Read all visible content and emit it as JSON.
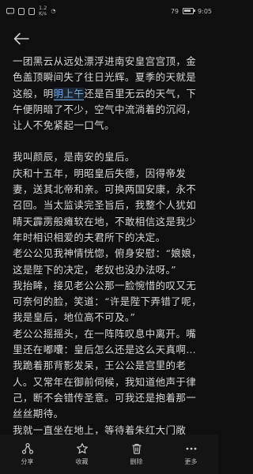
{
  "status_bar": {
    "left_icons": [
      "message-icon",
      "notification-icon",
      "notification-icon"
    ],
    "network_speed": "1.2",
    "network_unit": "K/s",
    "battery_percent": "79",
    "battery_level": 0.79,
    "time": "9:05"
  },
  "content": {
    "p1_before": "一团黑云从远处漂浮进南安皇宫宫顶，金色盖顶瞬间失了往日光辉。夏季的天就是这般，明",
    "p1_highlight": "明上午",
    "p1_after": "还是百里无云的天气，下午便阴暗了不少，空气中流淌着的沉闷，让人不免紧起一口气。",
    "p2": "我叫颜辰，是南安的皇后。",
    "p3": "庆和十五年，明昭皇后失德，因得帝发妻，送其北帝和亲。可换两国安康，永不召回。当太监读完圣旨后，我整个人犹如晴天霹雳般瘫软在地，不敢相信这是我少年时相识相爱的夫君所下的决定。",
    "p4": "老公公见我神情恍惚，俯身安慰：“娘娘，这是陛下的决定，老奴也没办法呀。”",
    "p5": "我抬眸，接见老公公那一脸惋惜的叹又无可奈何的脸，笑道：“许是陛下弄错了呢，我是皇后，地位高不可及。”",
    "p6": "老公公摇摇头，在一阵阵叹息中离开。嘴里还在嘟囔：皇后怎么还是这么天真啊…",
    "p7": "我跪着那背影发呆，王公公是宫里的老人。又常年在御前伺候，我知道他声于律己，断不会错传圣意。可我还是抱着那一丝丝期待。",
    "p8": "我就一直坐在地上，等待着朱红大门敞开，"
  },
  "toolbar": {
    "items": [
      {
        "label": "分享",
        "icon": "share-icon"
      },
      {
        "label": "收藏",
        "icon": "star-icon"
      },
      {
        "label": "删除",
        "icon": "trash-icon"
      },
      {
        "label": "更多",
        "icon": "more-icon"
      }
    ]
  }
}
